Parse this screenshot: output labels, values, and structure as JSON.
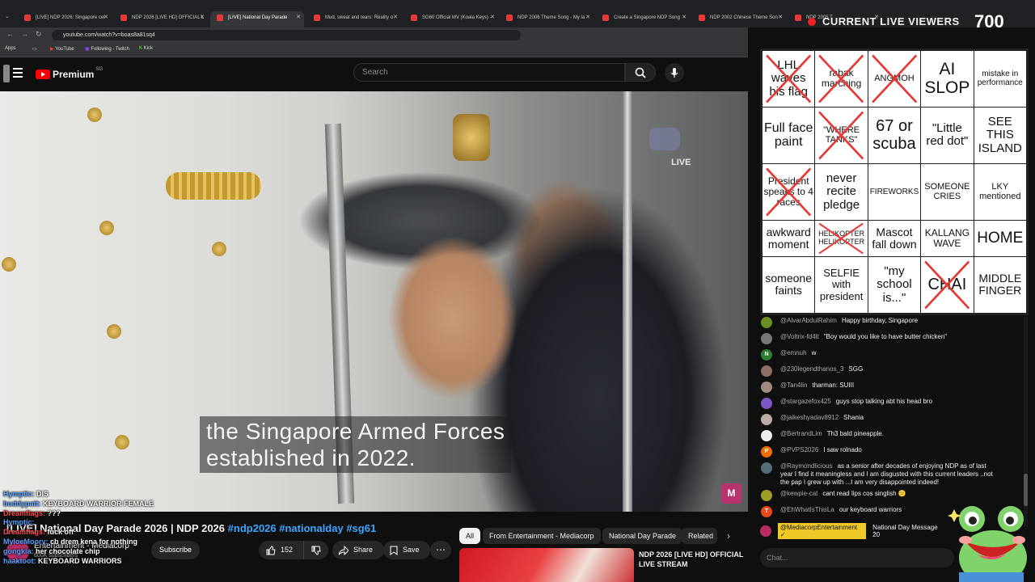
{
  "browser": {
    "tabs": [
      {
        "title": "[LIVE] NDP 2026: Singapore cel",
        "active": false
      },
      {
        "title": "NDP 2026 [LIVE HD] OFFICIAL L",
        "active": false
      },
      {
        "title": "[LIVE] National Day Parade",
        "active": true
      },
      {
        "title": "Mud, sweat and tears: Reality o",
        "active": false
      },
      {
        "title": "SG60 Official MV (Koala Keys) -",
        "active": false
      },
      {
        "title": "NDP 2006 Theme Song - My la",
        "active": false
      },
      {
        "title": "Create a Singapore NDP Song",
        "active": false
      },
      {
        "title": "NDP 2002 Chinese Theme Son",
        "active": false
      },
      {
        "title": "NDP 2005 T",
        "active": false
      }
    ],
    "url": "youtube.com/watch?v=boas8a81sq4",
    "bookmarks": [
      "Apps",
      "YouTube",
      "Following - Twitch",
      "Kick"
    ]
  },
  "youtube": {
    "logo_text": "Premium",
    "logo_region": "SG",
    "search_placeholder": "Search"
  },
  "video": {
    "subtitle_line1": "the Singapore Armed Forces",
    "subtitle_line2": "established in 2022.",
    "live_label": "LIVE",
    "title_main": "[LIVE] National Day Parade 2026 | NDP 2026",
    "title_tags": "#ndp2026 #nationalday #sg61",
    "channel_name": "Entertainment - Mediacorp",
    "subscriber_count": "600K subscribers",
    "subscribe_label": "Subscribe",
    "like_count": "152",
    "share_label": "Share",
    "save_label": "Save"
  },
  "overlay_chat": [
    {
      "user": "Hymptic:",
      "msg": "DIS",
      "red": false
    },
    {
      "user": "buddypatt:",
      "msg": "KEYBOARD WARRIOR FEMALE",
      "red": false
    },
    {
      "user": "Dreamflags:",
      "msg": "???",
      "red": true
    },
    {
      "user": "Hymptic:",
      "msg": "",
      "red": false
    },
    {
      "user": "Dreamflags:",
      "msg": "fuck off",
      "red": true
    },
    {
      "user": "MyloeMoory:",
      "msg": "cb drem kena for nothing",
      "red": false
    },
    {
      "user": "gongkia:",
      "msg": "her chocolate chip",
      "red": false
    },
    {
      "user": "haaktoot:",
      "msg": "KEYBOARD WARRIORS",
      "red": false
    }
  ],
  "filter_chips": [
    "All",
    "From Entertainment - Mediacorp",
    "National Day Parade",
    "Related"
  ],
  "related": {
    "title": "NDP 2026 [LIVE HD] OFFICIAL LIVE STREAM"
  },
  "viewers": {
    "label": "CURRENT LIVE VIEWERS",
    "count": "700"
  },
  "bingo": [
    [
      {
        "text": "LHL waves his flag",
        "crossed": true,
        "size": 15
      },
      {
        "text": "rabak marching",
        "crossed": true,
        "size": 12
      },
      {
        "text": "ANGMOH",
        "crossed": true,
        "size": 11
      },
      {
        "text": "AI SLOP",
        "crossed": false,
        "size": 21
      },
      {
        "text": "mistake in performance",
        "crossed": false,
        "size": 10
      }
    ],
    [
      {
        "text": "Full face paint",
        "crossed": false,
        "size": 16
      },
      {
        "text": "\"WHERE TANKS\"",
        "crossed": true,
        "size": 11
      },
      {
        "text": "67 or scuba",
        "crossed": false,
        "size": 20
      },
      {
        "text": "\"Little red dot\"",
        "crossed": false,
        "size": 15
      },
      {
        "text": "SEE THIS ISLAND",
        "crossed": false,
        "size": 15
      }
    ],
    [
      {
        "text": "President speaks to 4 races",
        "crossed": true,
        "size": 12
      },
      {
        "text": "never recite pledge",
        "crossed": false,
        "size": 15
      },
      {
        "text": "FIREWORKS",
        "crossed": false,
        "size": 10
      },
      {
        "text": "SOMEONE CRIES",
        "crossed": false,
        "size": 11
      },
      {
        "text": "LKY mentioned",
        "crossed": false,
        "size": 11
      }
    ],
    [
      {
        "text": "awkward moment",
        "crossed": false,
        "size": 14
      },
      {
        "text": "HELIKOPTER HELIKOPTER",
        "crossed": true,
        "size": 9
      },
      {
        "text": "Mascot fall down",
        "crossed": false,
        "size": 14
      },
      {
        "text": "KALLANG WAVE",
        "crossed": false,
        "size": 12
      },
      {
        "text": "HOME",
        "crossed": false,
        "size": 19
      }
    ],
    [
      {
        "text": "someone faints",
        "crossed": false,
        "size": 14
      },
      {
        "text": "SELFIE with president",
        "crossed": false,
        "size": 13
      },
      {
        "text": "\"my school is...\"",
        "crossed": false,
        "size": 15
      },
      {
        "text": "CHAI",
        "crossed": true,
        "size": 20
      },
      {
        "text": "MIDDLE FINGER",
        "crossed": false,
        "size": 14
      }
    ]
  ],
  "live_chat": [
    {
      "user": "@AlvarAbdulRahim",
      "msg": "Happy birthday, Singapore",
      "color": "#6b8e23",
      "initial": ""
    },
    {
      "user": "@Voltrix-fd4lt",
      "msg": "\"Boy would you like to have butter chicken\"",
      "color": "#777777",
      "initial": ""
    },
    {
      "user": "@emnuh",
      "msg": "w",
      "color": "#2e7d32",
      "initial": "N"
    },
    {
      "user": "@230legendthanos_3",
      "msg": "SGG",
      "color": "#8d6e63",
      "initial": ""
    },
    {
      "user": "@Tan4lin",
      "msg": "tharman: SUIII",
      "color": "#a1887f",
      "initial": ""
    },
    {
      "user": "@stargazefox425",
      "msg": "guys stop talking abt his head bro",
      "color": "#7e57c2",
      "initial": ""
    },
    {
      "user": "@jaikeshyadav8912",
      "msg": "Shania",
      "color": "#bcaaa4",
      "initial": ""
    },
    {
      "user": "@BertrandLim",
      "msg": "Th3 bald pineapple.",
      "color": "#eeeeee",
      "initial": ""
    },
    {
      "user": "@PVPS2026",
      "msg": "I saw rolnado",
      "color": "#ef6c00",
      "initial": "P"
    },
    {
      "user": "@Raymondlicious",
      "msg": "as a senior after decades of enjoying NDP as of last year I find it meaningless and I am disgusted with this current leaders ..not the pap I grew up with ...I am very disappointed indeed!",
      "color": "#546e7a",
      "initial": ""
    },
    {
      "user": "@kewpie-cat",
      "msg": "cant read lips cos singlish 😕",
      "color": "#9e9d24",
      "initial": ""
    },
    {
      "user": "@EhWhatIsThisLa",
      "msg": "our keyboard warriors",
      "color": "#e64a19",
      "initial": "T"
    }
  ],
  "pinned_chat": {
    "user": "@MediacorpEntertainment ✓",
    "msg": "National Day Message 20"
  },
  "chat_placeholder": "Chat...",
  "colors": {
    "accent_red": "#ff0000",
    "link_blue": "#3ea6ff",
    "pinned_yellow": "#f0c928"
  }
}
